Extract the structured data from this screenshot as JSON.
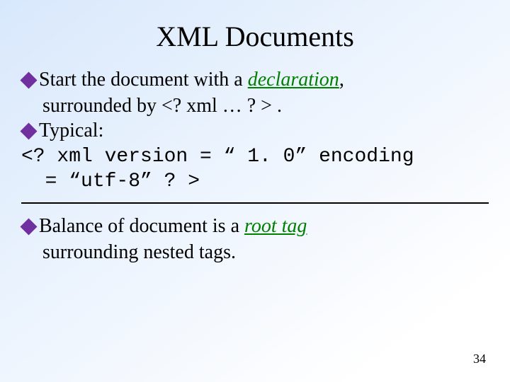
{
  "title": "XML Documents",
  "b1_a": "Start the document with a ",
  "b1_em": "declaration",
  "b1_b": ",",
  "b1_cont": "surrounded by <? xml … ? > .",
  "b2": "Typical:",
  "code1": "<? xml version = “ 1. 0” encoding",
  "code2": "  = “utf-8” ? >",
  "b3_a": "Balance of document is a ",
  "b3_em": "root tag",
  "b3_cont": "surrounding nested tags.",
  "page": "34"
}
